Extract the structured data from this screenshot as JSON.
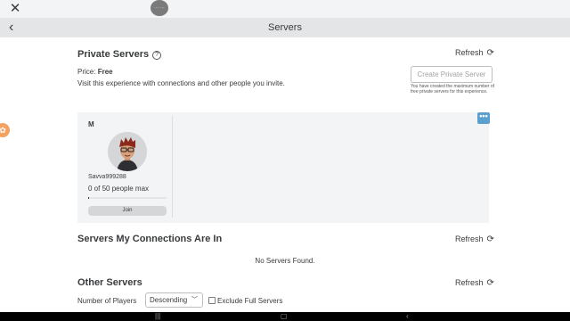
{
  "topbar": {
    "close_icon": "close-icon",
    "circle_label": "··· ···"
  },
  "header": {
    "title": "Servers",
    "back_icon": "chevron-left-icon"
  },
  "side_tab": {
    "icon": "gift-icon",
    "glyph": "✿"
  },
  "private_servers": {
    "title": "Private Servers",
    "help_glyph": "?",
    "refresh_label": "Refresh",
    "price_label": "Price:",
    "price_value": "Free",
    "visit_text": "Visit this experience with connections and other people you invite.",
    "create_button": "Create Private Server",
    "create_note": "You have created the maximum number of free private servers for this experience.",
    "menu_glyph": "•••",
    "servers": [
      {
        "name": "M",
        "player": "Savva999288",
        "capacity": "0 of 50 people max",
        "fill_fraction": 0.0,
        "join_label": "Join"
      }
    ]
  },
  "connections": {
    "title": "Servers My Connections Are In",
    "refresh_label": "Refresh",
    "empty_text": "No Servers Found."
  },
  "other_servers": {
    "title": "Other Servers",
    "refresh_label": "Refresh",
    "players_label": "Number of Players",
    "sort_value": "Descending",
    "exclude_label": "Exclude Full Servers",
    "exclude_checked": false
  },
  "colors": {
    "panel": "#f2f4f5",
    "header": "#e3e5e7",
    "menu_button": "#5b9fcf",
    "side_tab": "#f4a261"
  }
}
